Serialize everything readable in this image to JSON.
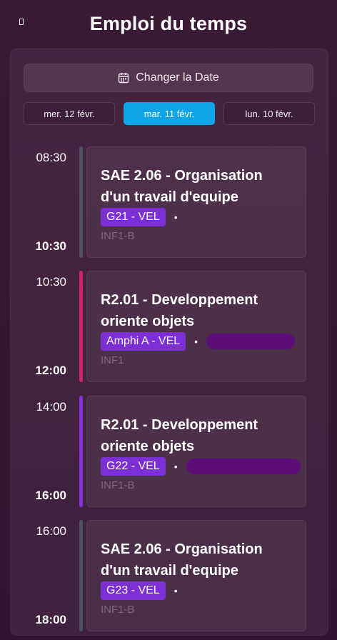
{
  "app": {
    "title": "Emploi du temps"
  },
  "date_button": {
    "label": "Changer la Date",
    "icon": "calendar-icon"
  },
  "day_tabs": [
    {
      "label": "mer. 12 févr.",
      "active": false
    },
    {
      "label": "mar. 11 févr.",
      "active": true
    },
    {
      "label": "lun. 10 févr.",
      "active": false
    }
  ],
  "events": [
    {
      "start": "08:30",
      "end": "10:30",
      "course": "SAE 2.06 - Organisation d'un travail d'equipe",
      "room": "G21 - VEL",
      "group": "INF1-B",
      "accent": "#4a5360",
      "teacher_redacted": false
    },
    {
      "start": "10:30",
      "end": "12:00",
      "course": "R2.01 - Developpement oriente objets",
      "room": "Amphi A - VEL",
      "group": "INF1",
      "accent": "#d0236e",
      "teacher_redacted": true
    },
    {
      "start": "14:00",
      "end": "16:00",
      "course": "R2.01 - Developpement oriente objets",
      "room": "G22 - VEL",
      "group": "INF1-B",
      "accent": "#8a2fe0",
      "teacher_redacted": true
    },
    {
      "start": "16:00",
      "end": "18:00",
      "course": "SAE 2.06 - Organisation d'un travail d'equipe",
      "room": "G23 - VEL",
      "group": "INF1-B",
      "accent": "#4a5360",
      "teacher_redacted": false
    }
  ],
  "colors": {
    "active_tab": "#0ea4e6",
    "room_badge": "#7c2fd4"
  }
}
